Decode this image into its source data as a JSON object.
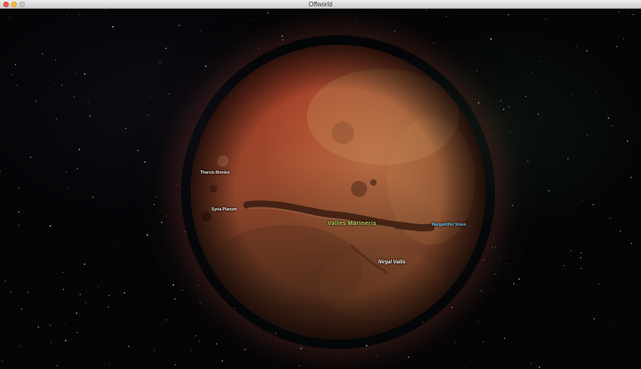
{
  "window": {
    "title": "Offworld"
  },
  "planet": {
    "features": {
      "tharsis": "Tharsis Montes",
      "syria": "Syria Planum",
      "valles": "Valles Marineris",
      "margaritifer": "Margaritifer Sinus",
      "nirgal": "Nirgal Vallis"
    }
  },
  "colors": {
    "valles_label": "#b8d860",
    "margaritifer_label": "#6ec4ea",
    "default_label": "#e8e8e8",
    "planet_rust": "#8e5433",
    "space_background": "#040507"
  }
}
